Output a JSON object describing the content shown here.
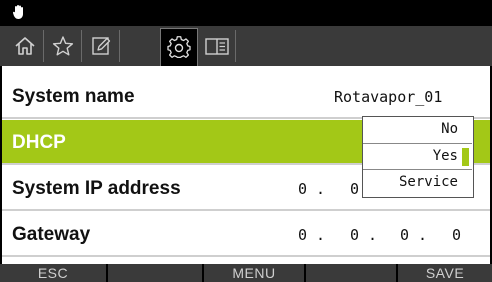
{
  "tabs": [
    {
      "icon": "home-icon"
    },
    {
      "icon": "star-icon"
    },
    {
      "icon": "edit-icon"
    },
    {
      "icon": "gear-icon",
      "active": true
    },
    {
      "icon": "book-icon"
    }
  ],
  "rows": [
    {
      "label": "System name",
      "value": "Rotavapor_01"
    },
    {
      "label": "DHCP",
      "selected": true
    },
    {
      "label": "System IP address",
      "octets": [
        "0",
        "0"
      ]
    },
    {
      "label": "Gateway",
      "octets": [
        "0",
        "0",
        "0",
        "0"
      ]
    }
  ],
  "dhcp_dropdown": {
    "options": [
      "No",
      "Yes",
      "Service"
    ],
    "selected": "Yes"
  },
  "softkeys": [
    "ESC",
    "",
    "MENU",
    "",
    "SAVE"
  ],
  "colors": {
    "accent": "#a3c817",
    "tabbar": "#3a3a3a",
    "background": "#000000"
  }
}
